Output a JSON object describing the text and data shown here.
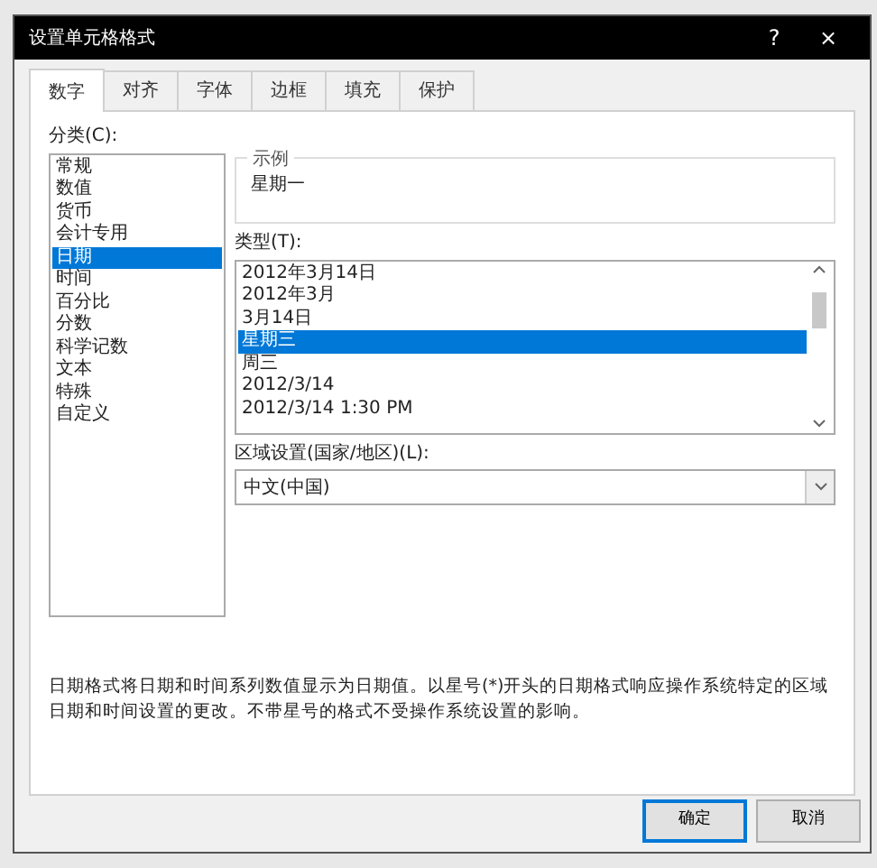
{
  "window": {
    "title": "设置单元格格式",
    "help": "?",
    "close": "×"
  },
  "tabs": [
    {
      "label": "数字",
      "selected": true
    },
    {
      "label": "对齐",
      "selected": false
    },
    {
      "label": "字体",
      "selected": false
    },
    {
      "label": "边框",
      "selected": false
    },
    {
      "label": "填充",
      "selected": false
    },
    {
      "label": "保护",
      "selected": false
    }
  ],
  "category": {
    "label": "分类(C):",
    "items": [
      {
        "label": "常规",
        "selected": false
      },
      {
        "label": "数值",
        "selected": false
      },
      {
        "label": "货币",
        "selected": false
      },
      {
        "label": "会计专用",
        "selected": false
      },
      {
        "label": "日期",
        "selected": true
      },
      {
        "label": "时间",
        "selected": false
      },
      {
        "label": "百分比",
        "selected": false
      },
      {
        "label": "分数",
        "selected": false
      },
      {
        "label": "科学记数",
        "selected": false
      },
      {
        "label": "文本",
        "selected": false
      },
      {
        "label": "特殊",
        "selected": false
      },
      {
        "label": "自定义",
        "selected": false
      }
    ]
  },
  "sample": {
    "label": "示例",
    "value": "星期一"
  },
  "type": {
    "label": "类型(T):",
    "items": [
      {
        "label": "2012年3月14日",
        "selected": false
      },
      {
        "label": "2012年3月",
        "selected": false
      },
      {
        "label": "3月14日",
        "selected": false
      },
      {
        "label": "星期三",
        "selected": true
      },
      {
        "label": "周三",
        "selected": false
      },
      {
        "label": "2012/3/14",
        "selected": false
      },
      {
        "label": "2012/3/14 1:30 PM",
        "selected": false
      }
    ]
  },
  "locale": {
    "label": "区域设置(国家/地区)(L):",
    "value": "中文(中国)"
  },
  "description": "日期格式将日期和时间系列数值显示为日期值。以星号(*)开头的日期格式响应操作系统特定的区域日期和时间设置的更改。不带星号的格式不受操作系统设置的影响。",
  "buttons": [
    {
      "label": "确定",
      "default": true
    },
    {
      "label": "取消",
      "default": false
    }
  ]
}
